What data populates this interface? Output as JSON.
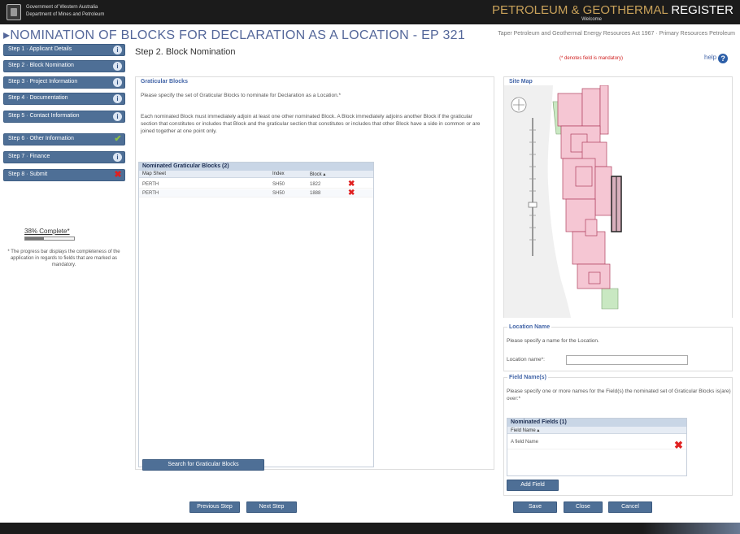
{
  "header": {
    "gov_line1": "Government of Western Australia",
    "gov_line2": "Department of Mines and Petroleum",
    "register_part1": "PETROLEUM & GEOTHERMAL ",
    "register_part2": "REGISTER",
    "welcome": "Welcome"
  },
  "title": {
    "main": "▸NOMINATION OF BLOCKS FOR DECLARATION AS A LOCATION - EP 321",
    "legislation": "Taper Petroleum and Geothermal Energy Resources Act 1967 · Primary Resources Petroleum"
  },
  "sidebar": {
    "steps": [
      {
        "label": "Step 1 · Applicant Details",
        "status": "info"
      },
      {
        "label": "Step 2 · Block Nomination",
        "status": "info"
      },
      {
        "label": "Step 3 · Project Information",
        "status": "info"
      },
      {
        "label": "Step 4 · Documentation",
        "status": "info"
      },
      {
        "label": "Step 5 · Contact Information",
        "status": "info"
      },
      {
        "label": "Step 6 · Other Information",
        "status": "complete"
      },
      {
        "label": "Step 7 · Finance",
        "status": "info"
      },
      {
        "label": "Step 8 · Submit",
        "status": "error"
      }
    ],
    "progress_label": "38% Complete*",
    "progress_value": 0.38,
    "progress_note": "* The progress bar displays the completeness of the application in regards to fields that are marked as mandatory."
  },
  "main": {
    "step_heading": "Step 2.  Block Nomination",
    "section_label": "Graticular Blocks",
    "para1": "Please specify the set of Graticular Blocks to nominate for Declaration as a Location.*",
    "para2": "Each nominated Block must immediately adjoin at least one other nominated Block. A Block immediately adjoins another Block if the graticular section that constitutes or includes that Block and the graticular section that constitutes or includes that other Block have a side in common or are joined together at one point only.",
    "grid_title": "Nominated Graticular Blocks (2)",
    "grid_columns": [
      "Map Sheet",
      "Index",
      "Block ▴"
    ],
    "grid_rows": [
      {
        "map_sheet": "PERTH",
        "index": "SH50",
        "block": "1822"
      },
      {
        "map_sheet": "PERTH",
        "index": "SH50",
        "block": "1888"
      }
    ],
    "search_button": "Search for Graticular Blocks"
  },
  "right": {
    "required_note": "(* denotes field is mandatory)",
    "help": "help",
    "map_label": "Site Map",
    "location_label": "Location Name",
    "location_para": "Please specify a name for the Location.",
    "location_field_label": "Location name*:",
    "location_value": "",
    "field_label": "Field Name(s)",
    "field_para": "Please specify one or more names for the Field(s) the nominated set of Graticular Blocks is(are) over:*",
    "fields_grid_title": "Nominated Fields (1)",
    "fields_grid_column": "Field Name ▴",
    "fields": [
      {
        "name": "A field Name"
      }
    ],
    "add_field_button": "Add Field"
  },
  "footer_buttons": {
    "previous": "Previous Step",
    "next": "Next Step",
    "save": "Save",
    "close": "Close",
    "cancel": "Cancel"
  },
  "colors": {
    "header_bg": "#1b1b1b",
    "step_button": "#4e6f96",
    "title_blue": "#54679a",
    "label_blue": "#4466a8",
    "map_pink": "#f5c6d3",
    "map_green": "#c9e8c2",
    "delete_red": "#e02020"
  }
}
